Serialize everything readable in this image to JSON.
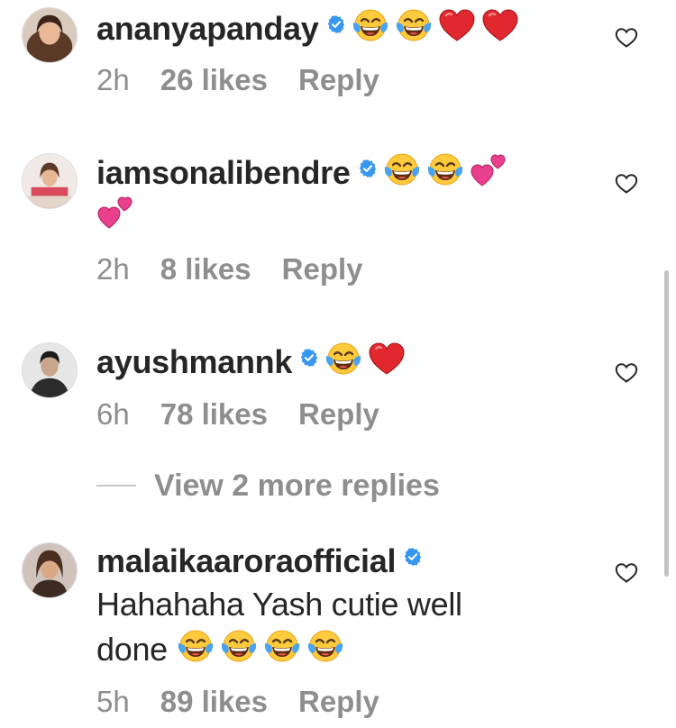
{
  "comments": [
    {
      "username": "ananyapanday",
      "verified": true,
      "text": "",
      "emojis": [
        "laughing-tears",
        "laughing-tears",
        "red-heart",
        "red-heart"
      ],
      "time": "2h",
      "likes": "26 likes",
      "reply": "Reply"
    },
    {
      "username": "iamsonalibendre",
      "verified": true,
      "text": "",
      "emojis": [
        "laughing-tears",
        "laughing-tears",
        "two-hearts",
        "two-hearts"
      ],
      "time": "2h",
      "likes": "8 likes",
      "reply": "Reply"
    },
    {
      "username": "ayushmannk",
      "verified": true,
      "text": "",
      "emojis": [
        "laughing-tears",
        "red-heart"
      ],
      "time": "6h",
      "likes": "78 likes",
      "reply": "Reply",
      "view_more": "View 2 more replies"
    },
    {
      "username": "malaikaaroraofficial",
      "verified": true,
      "text_line1": "Hahahaha Yash cutie well",
      "text_line2": "done",
      "emojis": [
        "laughing-tears",
        "laughing-tears",
        "laughing-tears",
        "laughing-tears"
      ],
      "time": "5h",
      "likes": "89 likes",
      "reply": "Reply"
    }
  ],
  "colors": {
    "username": "#262626",
    "meta": "#8e8e8e",
    "verified_badge": "#3897f0",
    "heart": "#e0282e",
    "pink_heart": "#e8408d"
  }
}
